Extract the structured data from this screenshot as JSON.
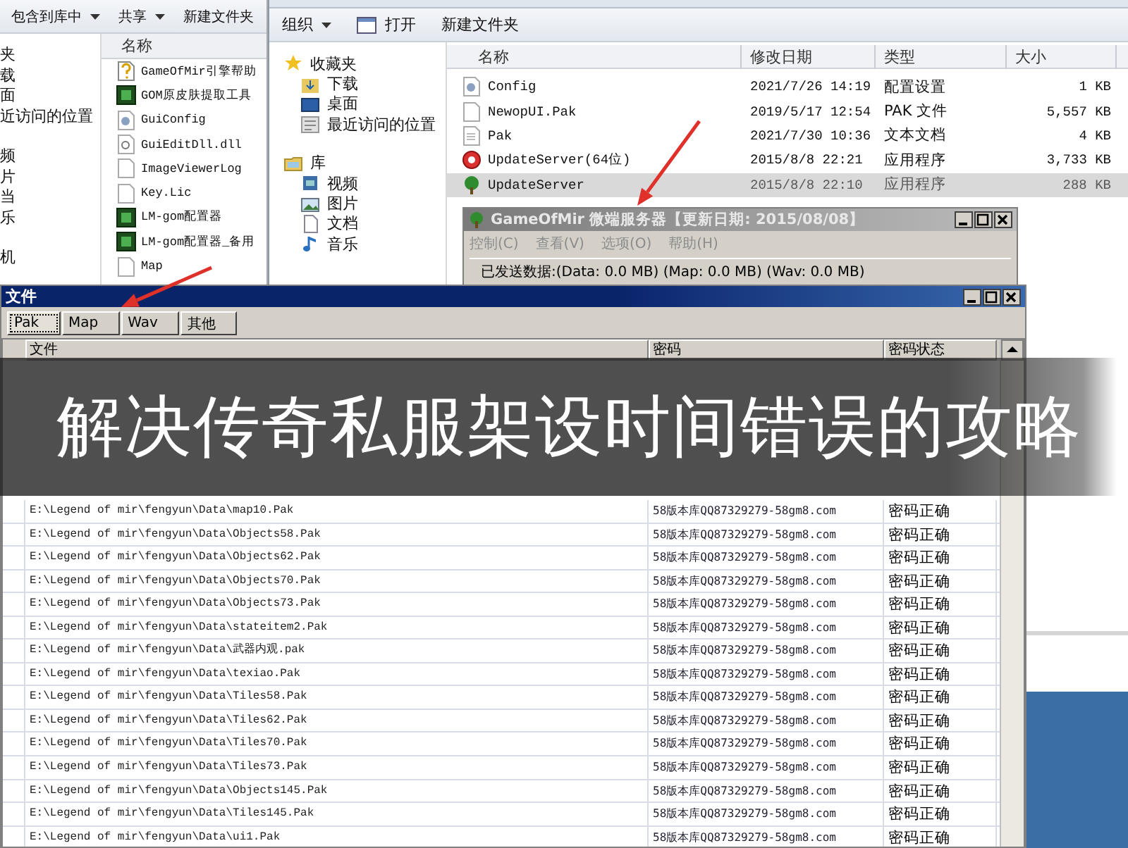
{
  "left_explorer": {
    "toolbar": [
      {
        "label": "包含到库中",
        "dropdown": true
      },
      {
        "label": "共享",
        "dropdown": true
      },
      {
        "label": "新建文件夹",
        "dropdown": false
      }
    ],
    "nav_groups": [
      {
        "items": [
          "夹",
          "载",
          "面",
          "近访问的位置"
        ]
      },
      {
        "items": [
          "频",
          "片",
          "当",
          "乐"
        ]
      },
      {
        "items": [
          "机"
        ]
      }
    ],
    "column": "名称",
    "files": [
      {
        "name": "GameOfMir引擎帮助",
        "kind": "help"
      },
      {
        "name": "GOM原皮肤提取工具",
        "kind": "app"
      },
      {
        "name": "GuiConfig",
        "kind": "config"
      },
      {
        "name": "GuiEditDll.dll",
        "kind": "dll"
      },
      {
        "name": "ImageViewerLog",
        "kind": "doc"
      },
      {
        "name": "Key.Lic",
        "kind": "doc"
      },
      {
        "name": "LM-gom配置器",
        "kind": "app"
      },
      {
        "name": "LM-gom配置器_备用",
        "kind": "app"
      },
      {
        "name": "Map",
        "kind": "doc"
      }
    ]
  },
  "right_explorer": {
    "toolbar": [
      {
        "label": "组织",
        "kind": "dropdown"
      },
      {
        "label": "打开",
        "kind": "icon"
      },
      {
        "label": "新建文件夹",
        "kind": "plain"
      }
    ],
    "nav": [
      {
        "label": "收藏夹",
        "kind": "star",
        "children": [
          {
            "label": "下载",
            "kind": "download"
          },
          {
            "label": "桌面",
            "kind": "desktop"
          },
          {
            "label": "最近访问的位置",
            "kind": "recent"
          }
        ]
      },
      {
        "label": "库",
        "kind": "library",
        "children": [
          {
            "label": "视频",
            "kind": "video"
          },
          {
            "label": "图片",
            "kind": "picture"
          },
          {
            "label": "文档",
            "kind": "document"
          },
          {
            "label": "音乐",
            "kind": "music"
          }
        ]
      }
    ],
    "columns": [
      "名称",
      "修改日期",
      "类型",
      "大小"
    ],
    "rows": [
      {
        "name": "Config",
        "date": "2021/7/26 14:19",
        "type": "配置设置",
        "size": "1 KB",
        "kind": "config",
        "selected": false
      },
      {
        "name": "NewopUI.Pak",
        "date": "2019/5/17 12:54",
        "type": "PAK 文件",
        "size": "5,557 KB",
        "kind": "doc",
        "selected": false
      },
      {
        "name": "Pak",
        "date": "2021/7/30 10:36",
        "type": "文本文档",
        "size": "4 KB",
        "kind": "text",
        "selected": false
      },
      {
        "name": "UpdateServer(64位)",
        "date": "2015/8/8 22:21",
        "type": "应用程序",
        "size": "3,733 KB",
        "kind": "red-app",
        "selected": false
      },
      {
        "name": "UpdateServer",
        "date": "2015/8/8 22:10",
        "type": "应用程序",
        "size": "288 KB",
        "kind": "tree-app",
        "selected": true
      }
    ]
  },
  "server_window": {
    "title": "GameOfMir 微端服务器【更新日期: 2015/08/08】",
    "active": false,
    "menu": [
      "控制(C)",
      "查看(V)",
      "选项(O)",
      "帮助(H)"
    ],
    "status": "已发送数据:(Data: 0.0 MB) (Map: 0.0 MB) (Wav: 0.0 MB)"
  },
  "file_window": {
    "title": "文件",
    "tabs": [
      {
        "label": "Pak",
        "selected": true
      },
      {
        "label": "Map",
        "selected": false
      },
      {
        "label": "Wav",
        "selected": false
      },
      {
        "label": "其他",
        "selected": false
      }
    ],
    "columns": [
      "文件",
      "密码",
      "密码状态"
    ],
    "rows": [
      {
        "file": "E:\\Legend of mir\\fengyun\\Data\\map10.Pak",
        "password": "58版本库QQ87329279-58gm8.com",
        "status": "密码正确"
      },
      {
        "file": "E:\\Legend of mir\\fengyun\\Data\\Objects58.Pak",
        "password": "58版本库QQ87329279-58gm8.com",
        "status": "密码正确"
      },
      {
        "file": "E:\\Legend of mir\\fengyun\\Data\\Objects62.Pak",
        "password": "58版本库QQ87329279-58gm8.com",
        "status": "密码正确"
      },
      {
        "file": "E:\\Legend of mir\\fengyun\\Data\\Objects70.Pak",
        "password": "58版本库QQ87329279-58gm8.com",
        "status": "密码正确"
      },
      {
        "file": "E:\\Legend of mir\\fengyun\\Data\\Objects73.Pak",
        "password": "58版本库QQ87329279-58gm8.com",
        "status": "密码正确"
      },
      {
        "file": "E:\\Legend of mir\\fengyun\\Data\\stateitem2.Pak",
        "password": "58版本库QQ87329279-58gm8.com",
        "status": "密码正确"
      },
      {
        "file": "E:\\Legend of mir\\fengyun\\Data\\武器内观.pak",
        "password": "58版本库QQ87329279-58gm8.com",
        "status": "密码正确"
      },
      {
        "file": "E:\\Legend of mir\\fengyun\\Data\\texiao.Pak",
        "password": "58版本库QQ87329279-58gm8.com",
        "status": "密码正确"
      },
      {
        "file": "E:\\Legend of mir\\fengyun\\Data\\Tiles58.Pak",
        "password": "58版本库QQ87329279-58gm8.com",
        "status": "密码正确"
      },
      {
        "file": "E:\\Legend of mir\\fengyun\\Data\\Tiles62.Pak",
        "password": "58版本库QQ87329279-58gm8.com",
        "status": "密码正确"
      },
      {
        "file": "E:\\Legend of mir\\fengyun\\Data\\Tiles70.Pak",
        "password": "58版本库QQ87329279-58gm8.com",
        "status": "密码正确"
      },
      {
        "file": "E:\\Legend of mir\\fengyun\\Data\\Tiles73.Pak",
        "password": "58版本库QQ87329279-58gm8.com",
        "status": "密码正确"
      },
      {
        "file": "E:\\Legend of mir\\fengyun\\Data\\Objects145.Pak",
        "password": "58版本库QQ87329279-58gm8.com",
        "status": "密码正确"
      },
      {
        "file": "E:\\Legend of mir\\fengyun\\Data\\Tiles145.Pak",
        "password": "58版本库QQ87329279-58gm8.com",
        "status": "密码正确"
      },
      {
        "file": "E:\\Legend of mir\\fengyun\\Data\\ui1.Pak",
        "password": "58版本库QQ87329279-58gm8.com",
        "status": "密码正确"
      }
    ]
  },
  "banner": {
    "text": "解决传奇私服架设时间错误的攻略"
  }
}
